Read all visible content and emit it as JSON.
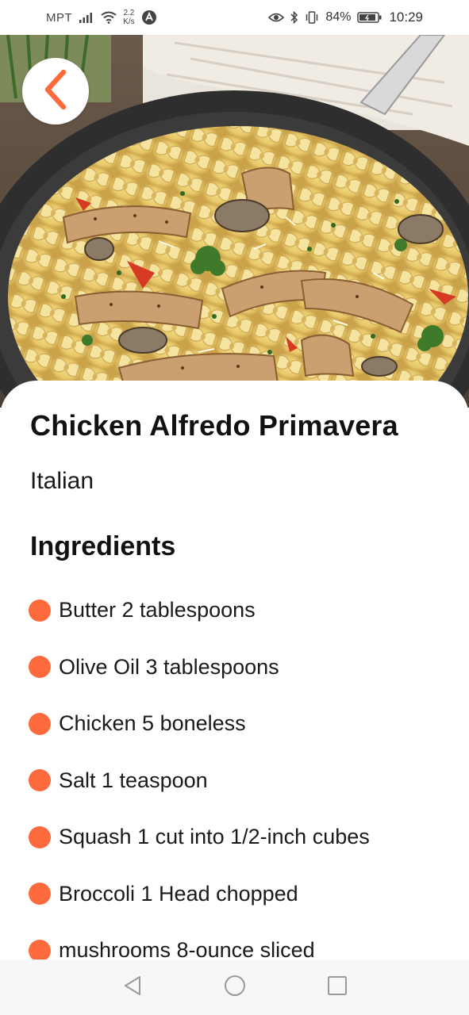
{
  "status_bar": {
    "carrier": "MPT",
    "net_speed_value": "2.2",
    "net_speed_unit": "K/s",
    "battery": "84%",
    "time": "10:29"
  },
  "recipe": {
    "title": "Chicken Alfredo Primavera",
    "cuisine": "Italian",
    "ingredients_heading": "Ingredients",
    "ingredients": [
      "Butter 2 tablespoons",
      "Olive Oil 3 tablespoons",
      "Chicken 5 boneless",
      "Salt 1 teaspoon",
      "Squash 1 cut into 1/2-inch cubes",
      "Broccoli 1 Head chopped",
      "mushrooms 8-ounce sliced"
    ]
  },
  "icons": {
    "back": "chevron-left-icon",
    "nav_back": "triangle-back-icon",
    "nav_home": "circle-home-icon",
    "nav_recents": "square-recents-icon"
  },
  "colors": {
    "accent": "#ff6a3d"
  }
}
